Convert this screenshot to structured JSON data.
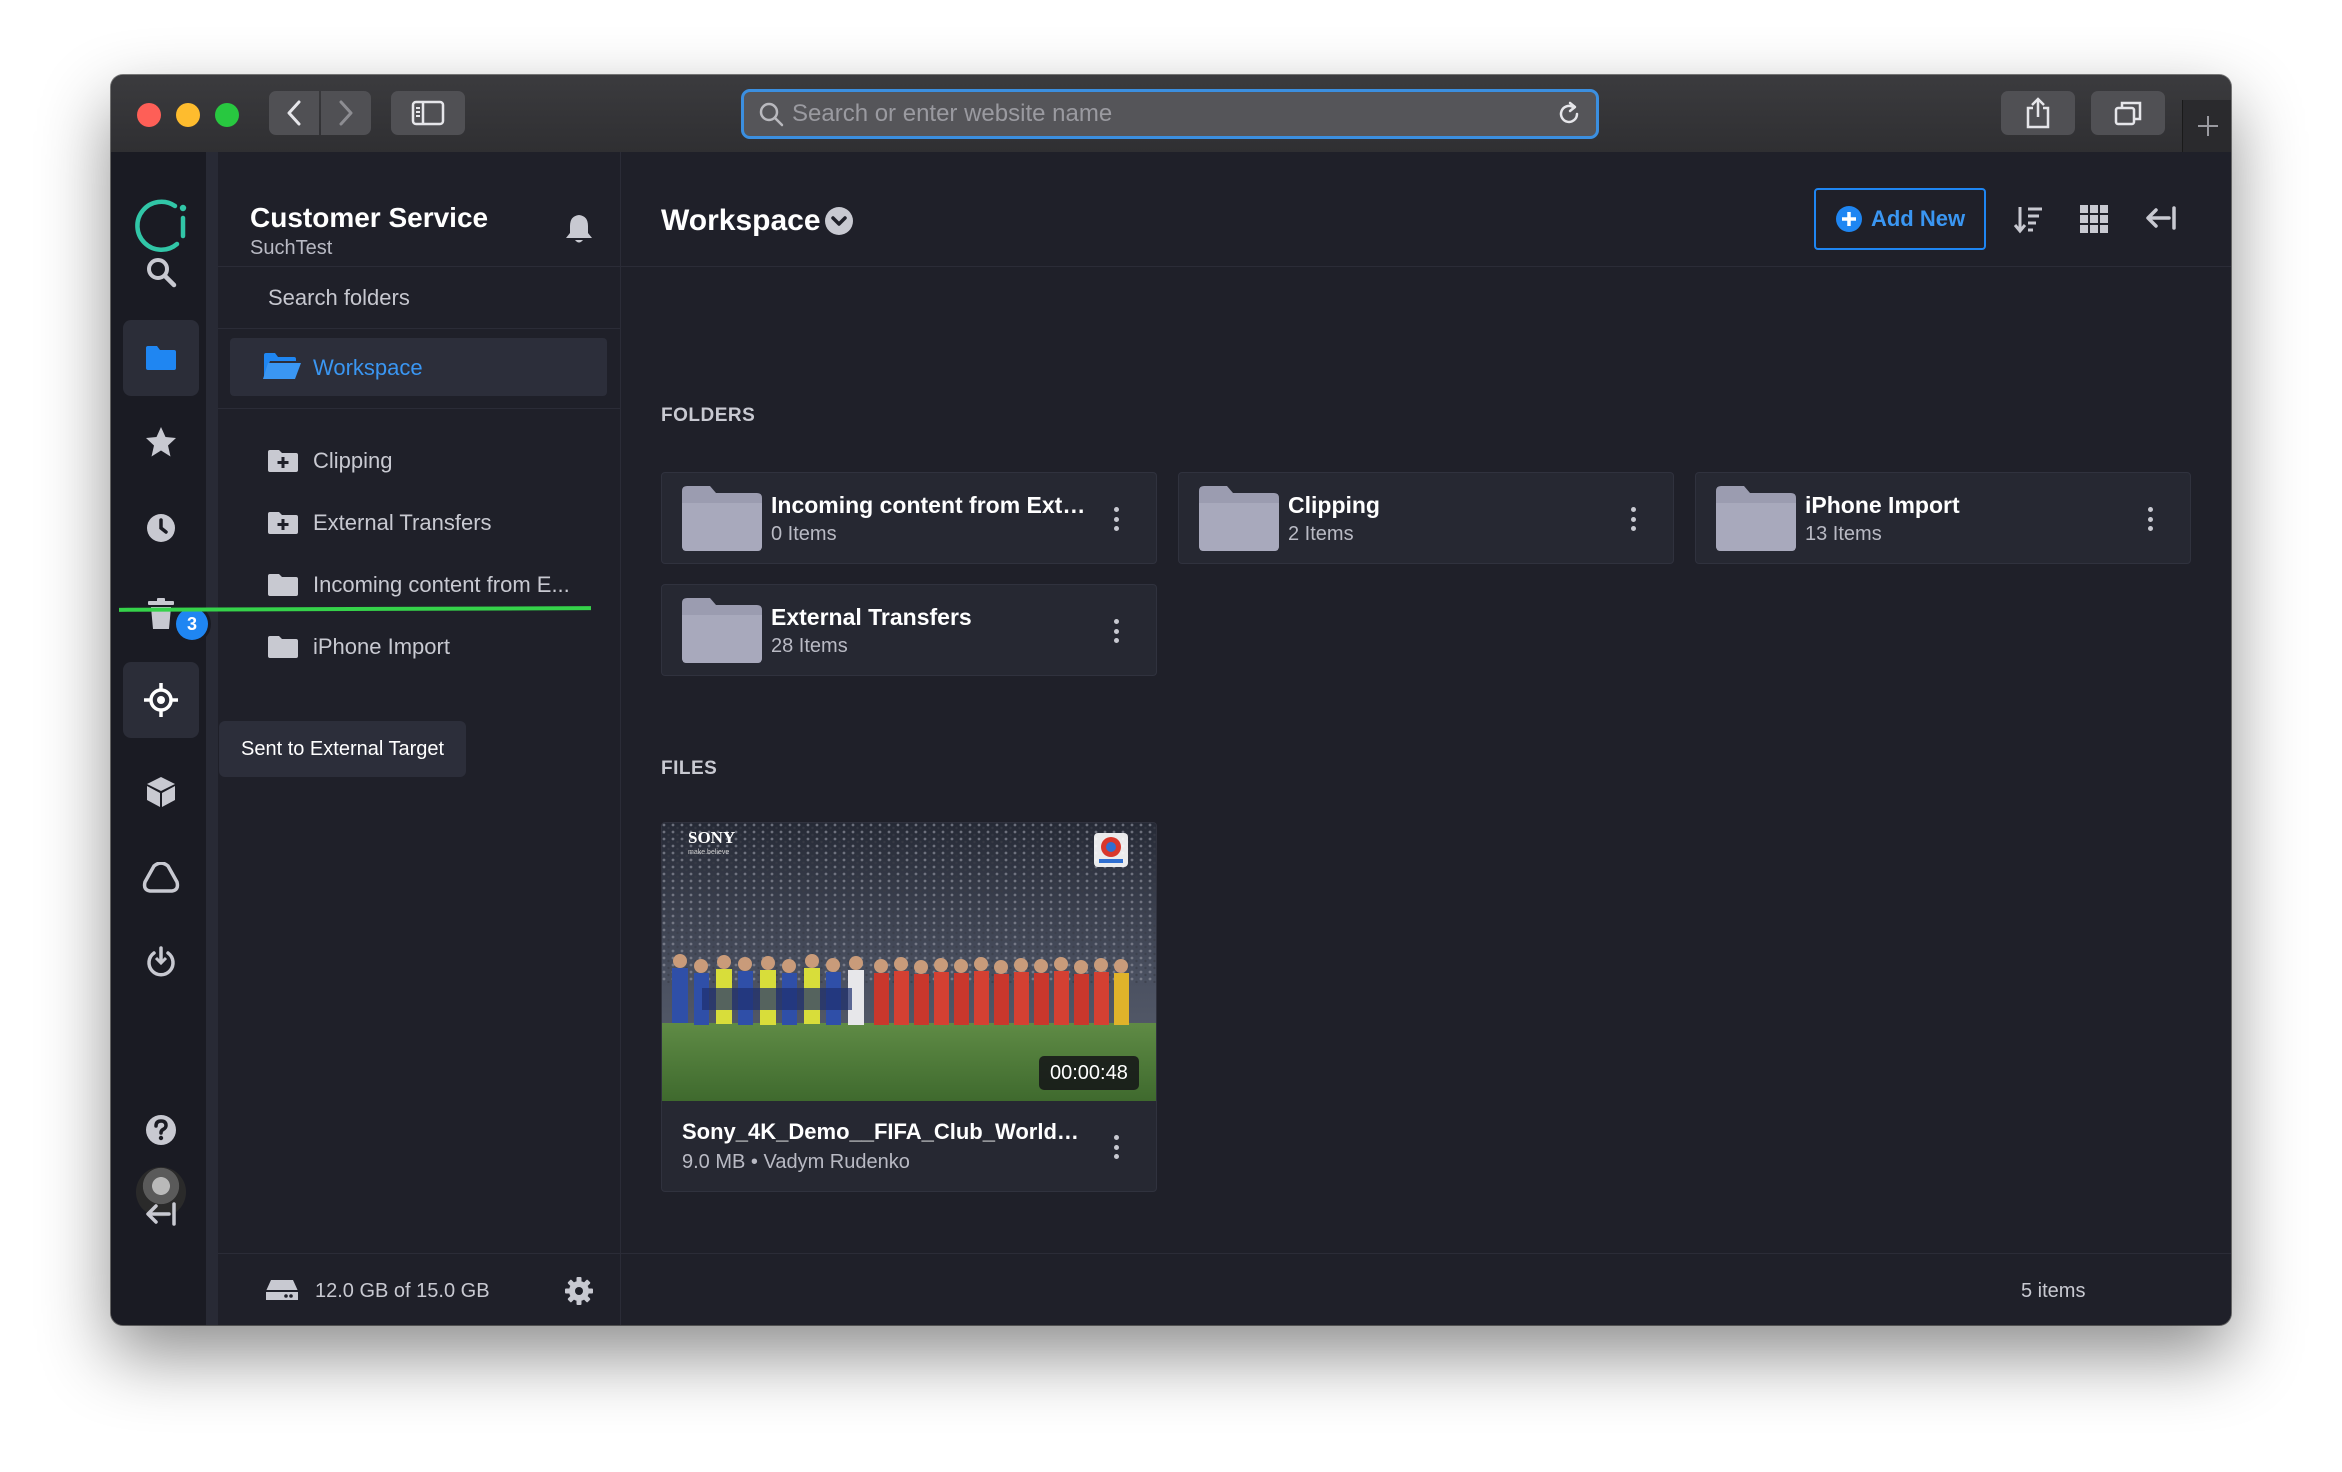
{
  "browser": {
    "url_placeholder": "Search or enter website name"
  },
  "rail": {
    "items": [
      "logo",
      "search",
      "folders",
      "favorites",
      "recent",
      "trash",
      "external-targets",
      "packages",
      "cloud",
      "power",
      "avatar",
      "help",
      "collapse"
    ],
    "recent_badge": "3",
    "tooltip": "Sent to External Target"
  },
  "panel": {
    "org_name": "Customer Service",
    "org_sub": "SuchTest",
    "search_placeholder": "Search folders",
    "workspace_label": "Workspace",
    "tree": [
      {
        "label": "Clipping",
        "icon": "folder-plus-icon"
      },
      {
        "label": "External Transfers",
        "icon": "folder-plus-icon"
      },
      {
        "label": "Incoming content from E...",
        "icon": "folder-icon"
      },
      {
        "label": "iPhone Import",
        "icon": "folder-icon"
      }
    ],
    "storage": "12.0 GB of 15.0 GB"
  },
  "main": {
    "title": "Workspace",
    "add_new": "Add New",
    "folders_label": "FOLDERS",
    "files_label": "FILES",
    "folders": [
      {
        "name": "Incoming content from Exte...",
        "count": "0 Items"
      },
      {
        "name": "Clipping",
        "count": "2 Items"
      },
      {
        "name": "iPhone Import",
        "count": "13 Items"
      },
      {
        "name": "External Transfers",
        "count": "28 Items"
      }
    ],
    "files": [
      {
        "name": "Sony_4K_Demo__FIFA_Club_World_Cu...",
        "meta": "9.0 MB • Vadym Rudenko",
        "duration": "00:00:48",
        "thumb_brand": "SONY",
        "thumb_tagline": "make.believe"
      }
    ],
    "item_count": "5 items"
  },
  "colors": {
    "accent": "#1f86f2",
    "background": "#1f2029",
    "card": "#262832",
    "logo": "#31c6a7"
  }
}
